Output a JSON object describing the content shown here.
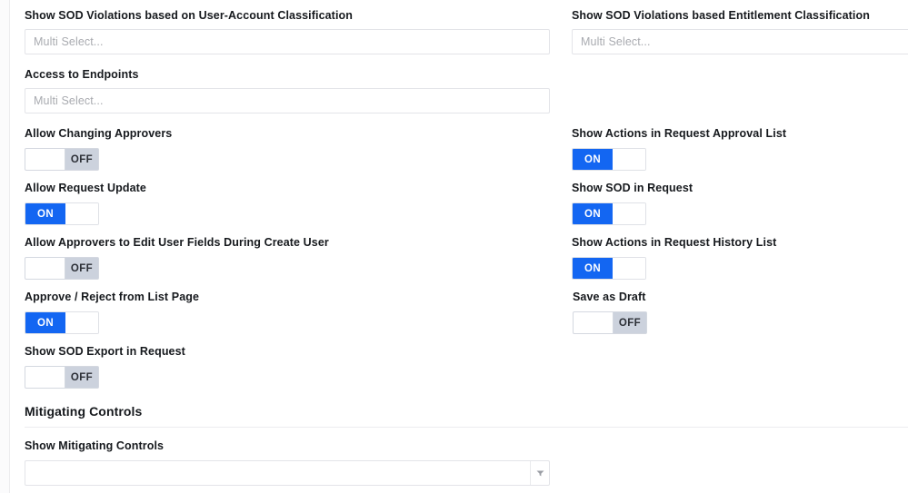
{
  "colors": {
    "toggle_on": "#1366f2",
    "toggle_off_track": "#ccd2dd",
    "label_text": "#16191d",
    "placeholder_text": "#a9abb0",
    "border": "#e3e4e8"
  },
  "left_column": {
    "fields": [
      {
        "id": "show-sod-violations-user-account",
        "label": "Show SOD Violations based on User-Account Classification",
        "type": "multiselect",
        "placeholder": "Multi Select...",
        "value": ""
      },
      {
        "id": "access-to-endpoints",
        "label": "Access to Endpoints",
        "type": "multiselect",
        "placeholder": "Multi Select...",
        "value": ""
      },
      {
        "id": "allow-changing-approvers",
        "label": "Allow Changing Approvers",
        "type": "toggle",
        "state": "OFF"
      },
      {
        "id": "allow-request-update",
        "label": "Allow Request Update",
        "type": "toggle",
        "state": "ON"
      },
      {
        "id": "allow-approvers-edit-user-fields",
        "label": "Allow Approvers to Edit User Fields During Create User",
        "type": "toggle",
        "state": "OFF"
      },
      {
        "id": "approve-reject-from-list-page",
        "label": "Approve / Reject from List Page",
        "type": "toggle",
        "state": "ON"
      },
      {
        "id": "show-sod-export-in-request",
        "label": "Show SOD Export in Request",
        "type": "toggle",
        "state": "OFF"
      }
    ]
  },
  "right_column": {
    "fields": [
      {
        "id": "show-sod-violations-entitlement",
        "label": "Show SOD Violations based Entitlement Classification",
        "type": "multiselect",
        "placeholder": "Multi Select...",
        "value": ""
      },
      {
        "id": "show-actions-in-request-approval-list",
        "label": "Show Actions in Request Approval List",
        "type": "toggle",
        "state": "ON"
      },
      {
        "id": "show-sod-in-request",
        "label": "Show SOD in Request",
        "type": "toggle",
        "state": "ON"
      },
      {
        "id": "show-actions-in-request-history-list",
        "label": "Show Actions in Request History List",
        "type": "toggle",
        "state": "ON"
      },
      {
        "id": "save-as-draft",
        "label": "Save as Draft",
        "type": "toggle",
        "state": "OFF"
      }
    ]
  },
  "mitigating_controls": {
    "section_title": "Mitigating Controls",
    "field": {
      "id": "show-mitigating-controls",
      "label": "Show Mitigating Controls",
      "type": "select",
      "value": "",
      "arrow_icon": "caret-down-icon"
    }
  }
}
